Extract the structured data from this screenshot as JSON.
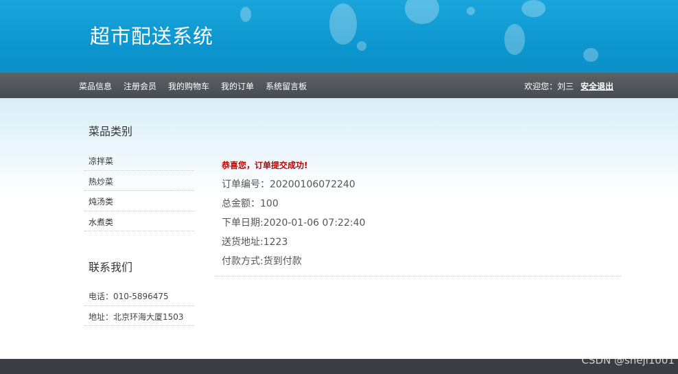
{
  "header": {
    "title": "超市配送系统"
  },
  "nav": {
    "items": [
      "菜品信息",
      "注册会员",
      "我的购物车",
      "我的订单",
      "系统留言板"
    ],
    "welcome": "欢迎您：刘三",
    "logout": "安全退出"
  },
  "sidebar": {
    "category_title": "菜品类别",
    "categories": [
      "凉拌菜",
      "热炒菜",
      "炖汤类",
      "水煮类"
    ],
    "contact_title": "联系我们",
    "phone": "电话：010-5896475",
    "address": "地址：北京环海大厦1503"
  },
  "order": {
    "success_msg": "恭喜您，订单提交成功!",
    "order_no": "订单编号：20200106072240",
    "total": "总金额：100",
    "date": "下单日期:2020-01-06 07:22:40",
    "address": "送货地址:1223",
    "payment": "付款方式:货到付款"
  },
  "watermark": "CSDN @sheji1001"
}
